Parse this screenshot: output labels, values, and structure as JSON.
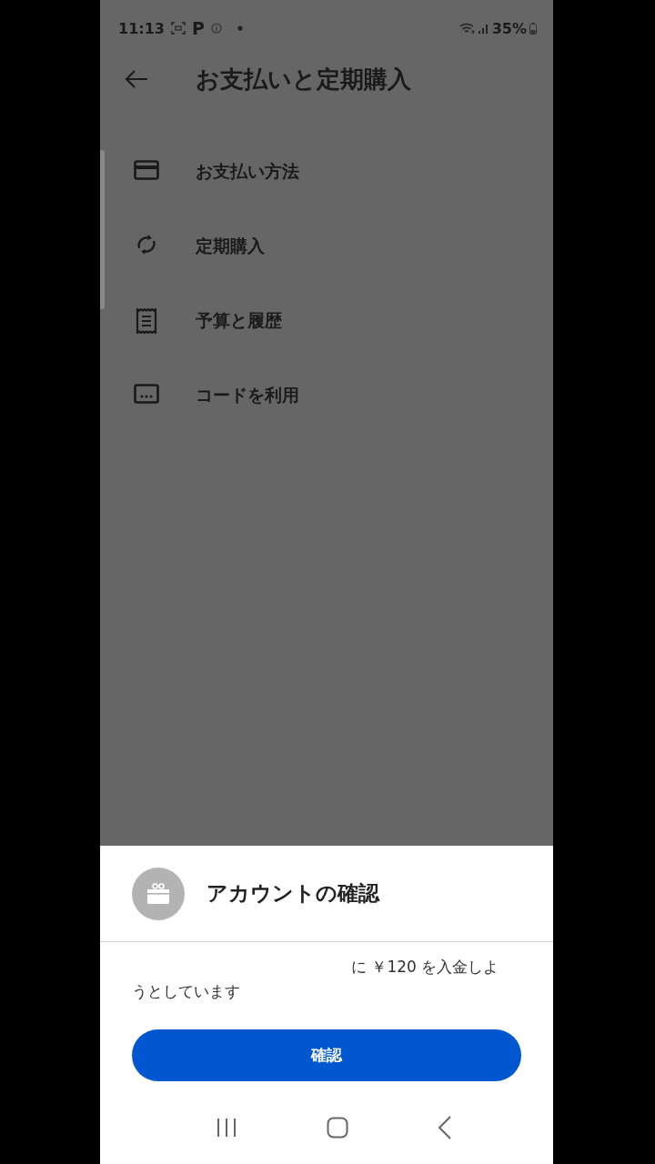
{
  "status_bar": {
    "time": "11:13",
    "notification": "P",
    "battery": "35%"
  },
  "header": {
    "title": "お支払いと定期購入"
  },
  "menu_items": [
    {
      "kind": "card",
      "label": "お支払い方法"
    },
    {
      "kind": "sync",
      "label": "定期購入"
    },
    {
      "kind": "receipt",
      "label": "予算と履歴"
    },
    {
      "kind": "code",
      "label": "コードを利用"
    }
  ],
  "sheet": {
    "title": "アカウントの確認",
    "message": "に ￥120 を入金しようとしています",
    "confirm_button": "確認"
  }
}
